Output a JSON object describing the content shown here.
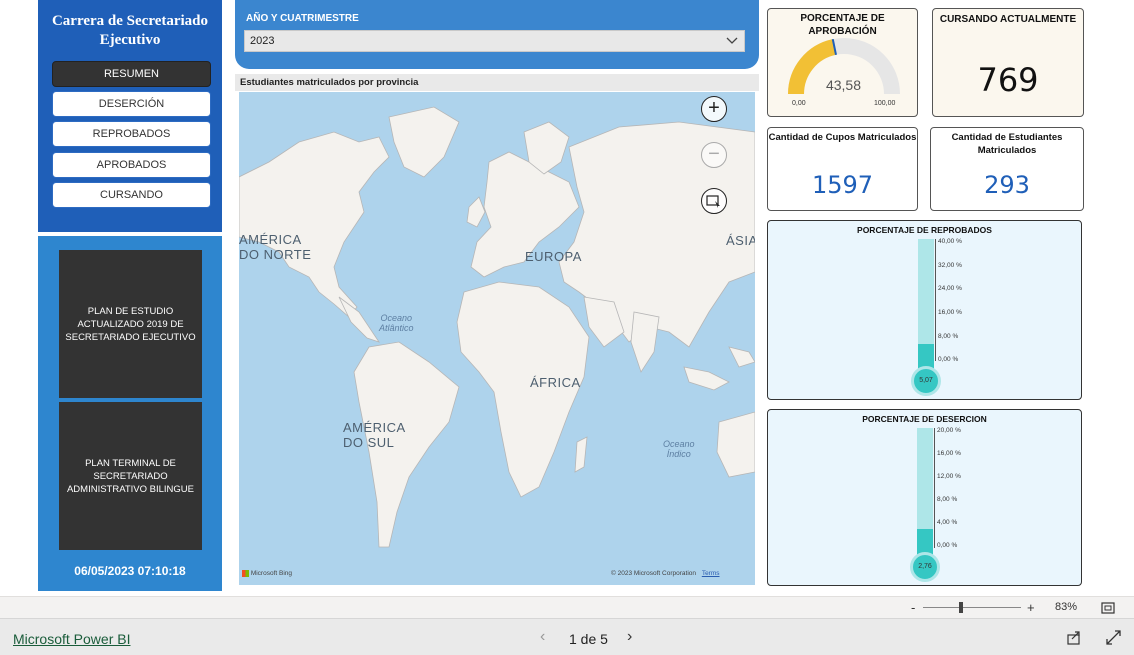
{
  "sidebar": {
    "title": "Carrera de Secretariado Ejecutivo",
    "nav_items": [
      {
        "label": "RESUMEN",
        "active": true
      },
      {
        "label": "DESERCIÓN",
        "active": false
      },
      {
        "label": "REPROBADOS",
        "active": false
      },
      {
        "label": "APROBADOS",
        "active": false
      },
      {
        "label": "CURSANDO",
        "active": false
      }
    ],
    "plans": [
      {
        "label": "PLAN DE ESTUDIO ACTUALIZADO 2019 DE SECRETARIADO EJECUTIVO"
      },
      {
        "label": "PLAN TERMINAL DE SECRETARIADO ADMINISTRATIVO BILINGUE"
      }
    ],
    "timestamp": "06/05/2023 07:10:18"
  },
  "filter": {
    "label": "AÑO Y CUATRIMESTRE",
    "value": "2023"
  },
  "map": {
    "title": "Estudiantes matriculados por provincia",
    "labels": {
      "north_america": "AMÉRICA\nDO NORTE",
      "europe": "EUROPA",
      "asia": "ÁSIA",
      "africa": "ÁFRICA",
      "south_america": "AMÉRICA\nDO SUL",
      "atlantic": "Oceano\nAtlântico",
      "indian": "Oceano\nÍndico"
    },
    "attribution": "Microsoft Bing",
    "copyright": "© 2023 Microsoft Corporation",
    "terms": "Terms",
    "controls": [
      "zoom-in",
      "zoom-out",
      "select"
    ]
  },
  "kpis": {
    "approval_rate": {
      "title": "PORCENTAJE DE APROBACIÓN",
      "value": "43,58",
      "min": "0,00",
      "max": "100,00",
      "fraction": 0.4358
    },
    "currently_enrolled": {
      "title": "CURSANDO ACTUALMENTE",
      "value": "769"
    },
    "seats_enrolled": {
      "title": "Cantidad de Cupos Matriculados",
      "value": "1597"
    },
    "students_enrolled": {
      "title": "Cantidad de Estudiantes Matriculados",
      "value": "293"
    }
  },
  "thermometers": [
    {
      "title": "PORCENTAJE DE REPROBADOS",
      "value": "5,07",
      "fraction": 0.1268,
      "ticks": [
        "40,00 %",
        "32,00 %",
        "24,00 %",
        "16,00 %",
        "8,00 %",
        "0,00 %"
      ]
    },
    {
      "title": "PORCENTAJE DE DESERCION",
      "value": "2,76",
      "fraction": 0.138,
      "ticks": [
        "20,00 %",
        "16,00 %",
        "12,00 %",
        "8,00 %",
        "4,00 %",
        "0,00 %"
      ]
    }
  ],
  "zoom": {
    "minus": "-",
    "plus": "+",
    "level": "83%"
  },
  "footer": {
    "brand": "Microsoft Power BI",
    "page_indicator": "1 de 5",
    "prev": "‹",
    "next": "›"
  },
  "colors": {
    "sidebar_blue": "#1f5fb8",
    "plan_blue": "#2e86cf",
    "gauge_fill": "#f2c035",
    "kpi_blue": "#1f5fb8",
    "thermo_fill": "#35c7c3",
    "thermo_tube": "#aee6e8"
  }
}
